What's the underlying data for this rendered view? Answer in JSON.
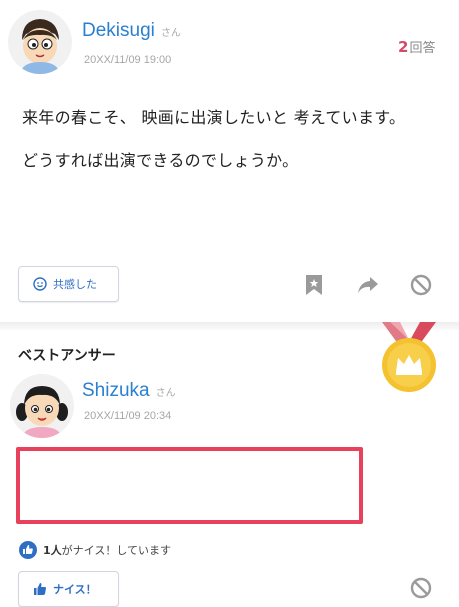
{
  "question": {
    "user": {
      "name": "Dekisugi",
      "honorific": "さん"
    },
    "date": "20XX/11/09 19:00",
    "answer_count": "2",
    "answer_suffix": "回答",
    "lines": [
      "来年の春こそ、 映画に出演したいと 考えています。",
      "どうすれば出演できるのでしょうか。"
    ],
    "empathy_label": "共感した",
    "icons": [
      "bookmark-icon",
      "share-arrow-icon",
      "block-icon"
    ]
  },
  "best_answer": {
    "title": "ベストアンサー",
    "user": {
      "name": "Shizuka",
      "honorific": "さん"
    },
    "date": "20XX/11/09 20:34",
    "like_count": "1人",
    "like_text": "がナイス！しています",
    "nice_label": "ナイス！",
    "colors": {
      "highlight": "#e8415b",
      "medal": "#f5c22f",
      "ribbon": "#d94a5c"
    }
  }
}
